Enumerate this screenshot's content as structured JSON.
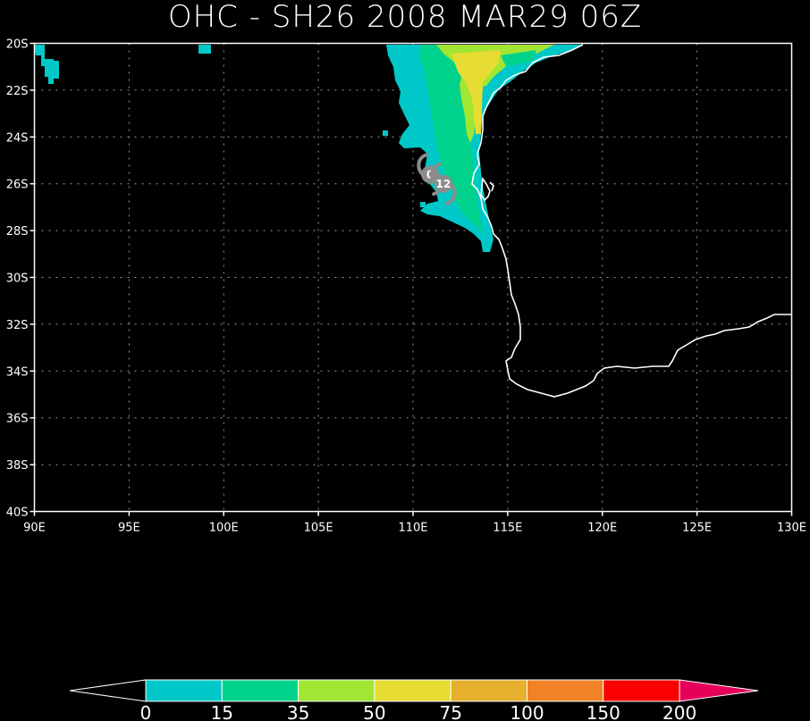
{
  "title": "OHC - SH26 2008 MAR29 06Z",
  "map": {
    "lon_range": [
      90,
      130
    ],
    "lat_range": [
      -40,
      -20
    ],
    "lon_ticks": [
      "90E",
      "95E",
      "100E",
      "105E",
      "110E",
      "115E",
      "120E",
      "125E",
      "130E"
    ],
    "lat_ticks": [
      "20S",
      "22S",
      "24S",
      "26S",
      "28S",
      "30S",
      "32S",
      "34S",
      "36S",
      "38S",
      "40S"
    ],
    "grid": true,
    "background_color": "#000000",
    "coast_color": "#ffffff"
  },
  "storm_track": {
    "icon": "tropical-cyclone-icon",
    "color": "#8c8c8c",
    "positions": [
      {
        "label": "0",
        "lon": 110.9,
        "lat": -25.6
      },
      {
        "label": "12",
        "lon": 111.6,
        "lat": -26.0
      }
    ]
  },
  "colorbar": {
    "labels": [
      "0",
      "15",
      "35",
      "50",
      "75",
      "100",
      "150",
      "200"
    ],
    "colors": [
      "#00c8c8",
      "#00d28c",
      "#a0e632",
      "#e6dc32",
      "#e6af2d",
      "#f08228",
      "#fa0000",
      "#e6005a"
    ]
  }
}
